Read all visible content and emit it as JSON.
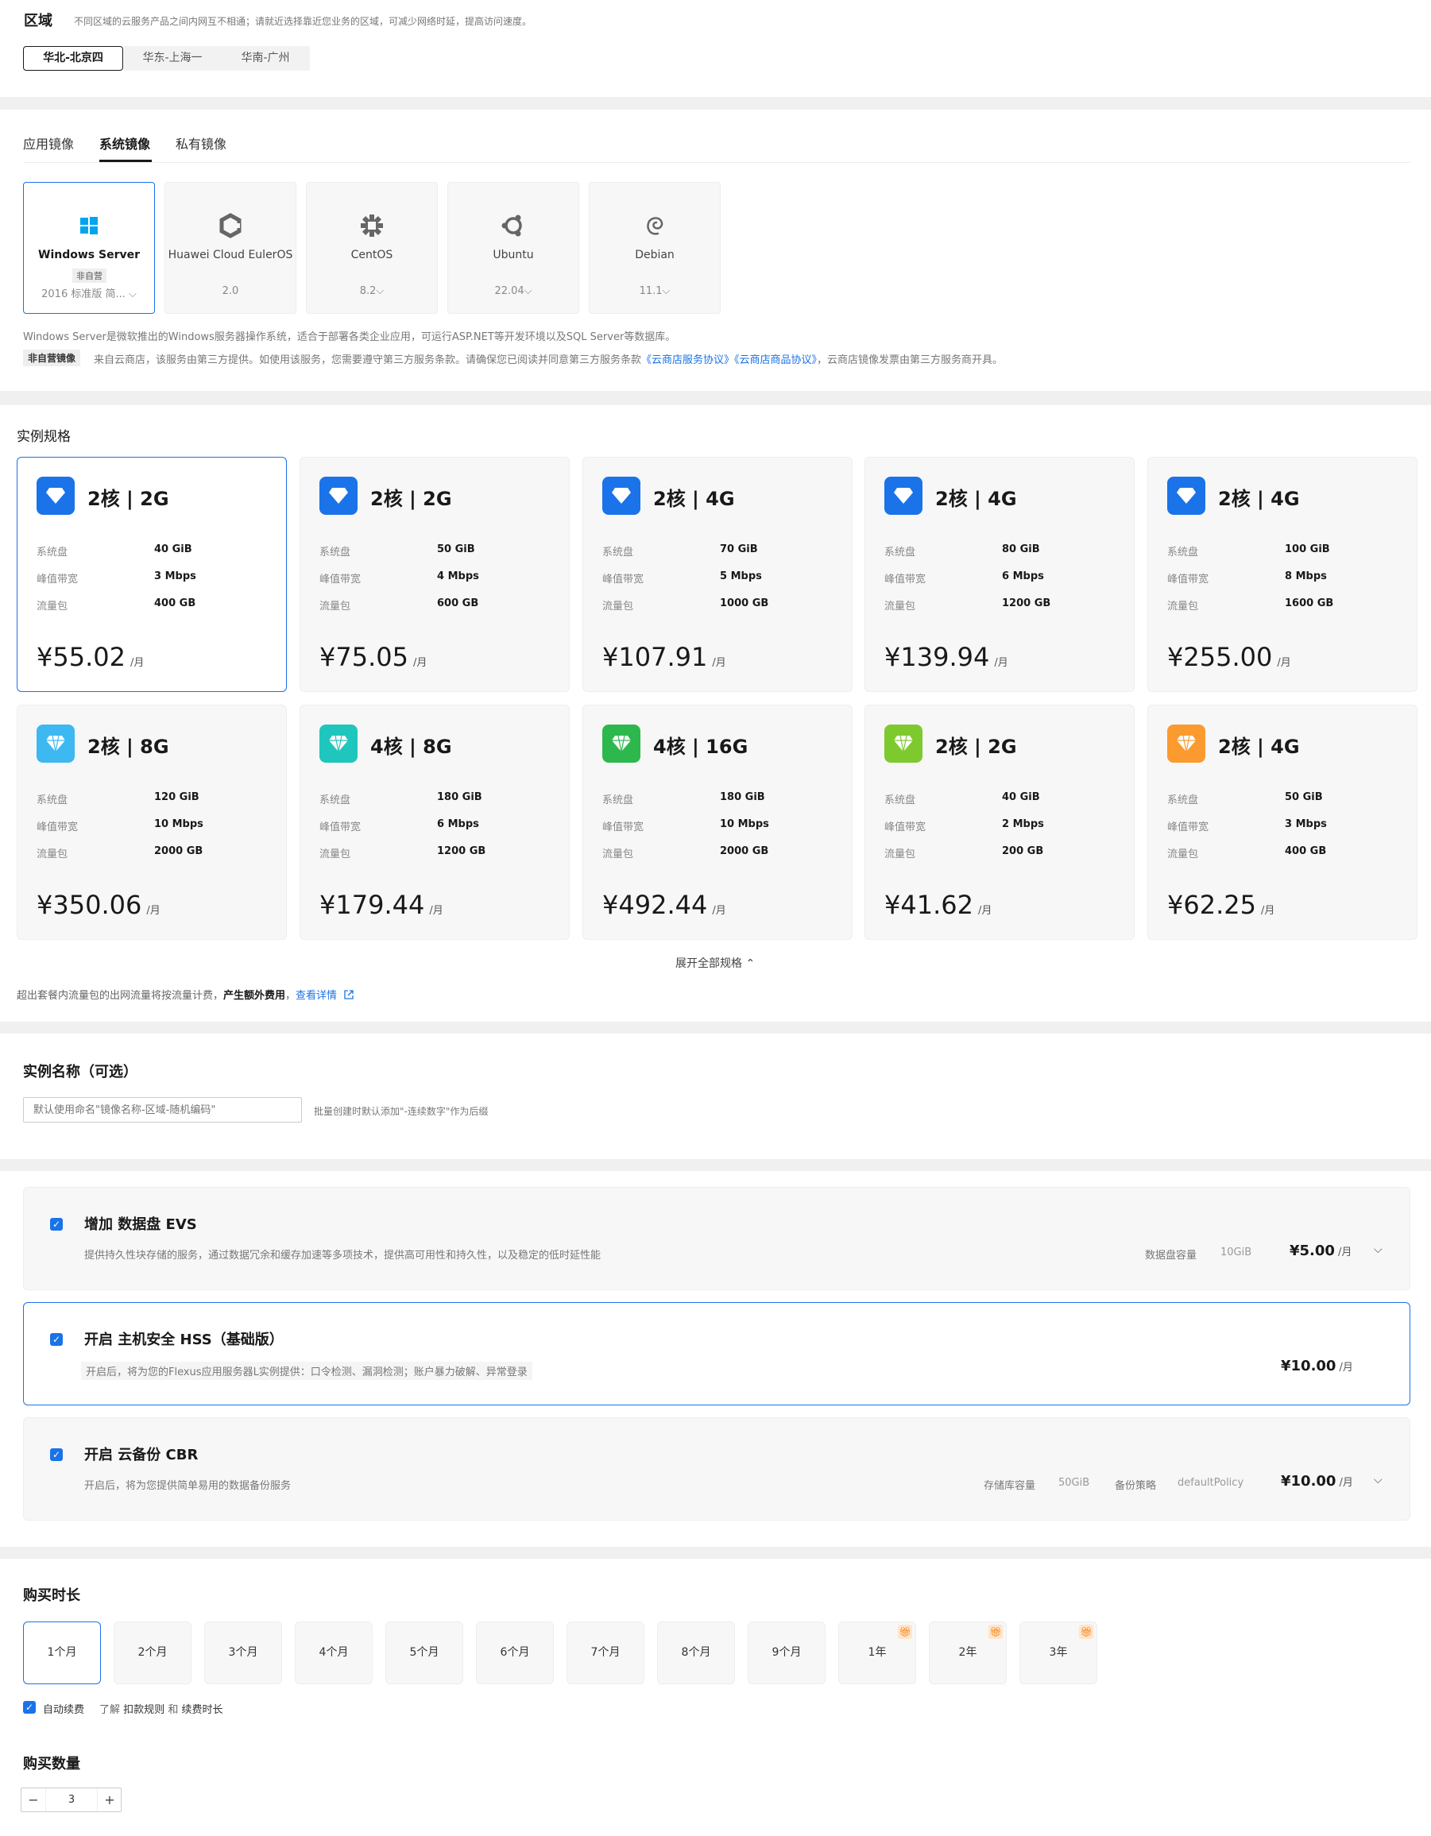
{
  "region": {
    "title": "区域",
    "hint": "不同区域的云服务产品之间内网互不相通；请就近选择靠近您业务的区域，可减少网络时延，提高访问速度。",
    "options": [
      "华北-北京四",
      "华东-上海一",
      "华南-广州"
    ],
    "selected": 0
  },
  "image": {
    "tabs": [
      "应用镜像",
      "系统镜像",
      "私有镜像"
    ],
    "selected_tab": 1,
    "os_cards": [
      {
        "name": "Windows Server",
        "badge": "非自营",
        "version": "2016 标准版 简... ⌵"
      },
      {
        "name": "Huawei Cloud EulerOS",
        "version": "2.0"
      },
      {
        "name": "CentOS",
        "version": "8.2⌵"
      },
      {
        "name": "Ubuntu",
        "version": "22.04⌵"
      },
      {
        "name": "Debian",
        "version": "11.1⌵"
      }
    ],
    "desc": "Windows Server是微软推出的Windows服务器操作系统，适合于部署各类企业应用，可运行ASP.NET等开发环境以及SQL Server等数据库。",
    "badge": "非自营镜像",
    "notice_pre": "来自云商店，该服务由第三方提供。如使用该服务，您需要遵守第三方服务条款。请确保您已阅读并同意第三方服务条款",
    "link1": "《云商店服务协议》",
    "link2": "《云商店商品协议》",
    "notice_post": "，云商店镜像发票由第三方服务商开具。"
  },
  "spec": {
    "title": "实例规格",
    "labels": [
      "系统盘",
      "峰值带宽",
      "流量包"
    ],
    "unit": "/月",
    "cards": [
      {
        "title": "2核 | 2G",
        "disk": "40 GiB",
        "bw": "3 Mbps",
        "traffic": "400 GB",
        "price": "¥55.02",
        "color": "#1a73e8"
      },
      {
        "title": "2核 | 2G",
        "disk": "50 GiB",
        "bw": "4 Mbps",
        "traffic": "600 GB",
        "price": "¥75.05",
        "color": "#1a73e8"
      },
      {
        "title": "2核 | 4G",
        "disk": "70 GiB",
        "bw": "5 Mbps",
        "traffic": "1000 GB",
        "price": "¥107.91",
        "color": "#1a73e8"
      },
      {
        "title": "2核 | 4G",
        "disk": "80 GiB",
        "bw": "6 Mbps",
        "traffic": "1200 GB",
        "price": "¥139.94",
        "color": "#1a73e8"
      },
      {
        "title": "2核 | 4G",
        "disk": "100 GiB",
        "bw": "8 Mbps",
        "traffic": "1600 GB",
        "price": "¥255.00",
        "color": "#1a73e8"
      },
      {
        "title": "2核 | 8G",
        "disk": "120 GiB",
        "bw": "10 Mbps",
        "traffic": "2000 GB",
        "price": "¥350.06",
        "color": "#3db8f0"
      },
      {
        "title": "4核 | 8G",
        "disk": "180 GiB",
        "bw": "6 Mbps",
        "traffic": "1200 GB",
        "price": "¥179.44",
        "color": "#1fc6bd"
      },
      {
        "title": "4核 | 16G",
        "disk": "180 GiB",
        "bw": "10 Mbps",
        "traffic": "2000 GB",
        "price": "¥492.44",
        "color": "#2db84d"
      },
      {
        "title": "2核 | 2G",
        "disk": "40 GiB",
        "bw": "2 Mbps",
        "traffic": "200 GB",
        "price": "¥41.62",
        "color": "#7ec92e"
      },
      {
        "title": "2核 | 4G",
        "disk": "50 GiB",
        "bw": "3 Mbps",
        "traffic": "400 GB",
        "price": "¥62.25",
        "color": "#fa9a2f"
      }
    ],
    "expand": "展开全部规格 ⌃",
    "footnote_pre": "超出套餐内流量包的出网流量将按流量计费，",
    "footnote_bold": "产生额外费用",
    "footnote_sep": "，",
    "footnote_link": "查看详情"
  },
  "name": {
    "title": "实例名称（可选）",
    "placeholder": "默认使用命名\"镜像名称-区域-随机编码\"",
    "hint": "批量创建时默认添加\"-连续数字\"作为后缀"
  },
  "addons": [
    {
      "title": "增加 数据盘 EVS",
      "desc": "提供持久性块存储的服务，通过数据冗余和缓存加速等多项技术，提供高可用性和持久性，以及稳定的低时延性能",
      "meta1_k": "数据盘容量",
      "meta1_v": "10GiB",
      "price": "¥5.00",
      "unit": "/月"
    },
    {
      "title": "开启 主机安全 HSS（基础版）",
      "desc": "开启后，将为您的Flexus应用服务器L实例提供：口令检测、漏洞检测；账户暴力破解、异常登录",
      "price": "¥10.00",
      "unit": "/月"
    },
    {
      "title": "开启 云备份 CBR",
      "desc": "开启后，将为您提供简单易用的数据备份服务",
      "meta1_k": "存储库容量",
      "meta1_v": "50GiB",
      "meta2_k": "备份策略",
      "meta2_v": "defaultPolicy",
      "price": "¥10.00",
      "unit": "/月"
    }
  ],
  "duration": {
    "title": "购买时长",
    "options": [
      "1个月",
      "2个月",
      "3个月",
      "4个月",
      "5个月",
      "6个月",
      "7个月",
      "8个月",
      "9个月",
      "1年",
      "2年",
      "3年"
    ],
    "selected": 0,
    "auto_renew": "自动续费",
    "learn": "了解",
    "rule": "扣款规则",
    "and": "和",
    "renew_len": "续费时长"
  },
  "quantity": {
    "title": "购买数量",
    "value": "3",
    "minus": "−",
    "plus": "+"
  }
}
